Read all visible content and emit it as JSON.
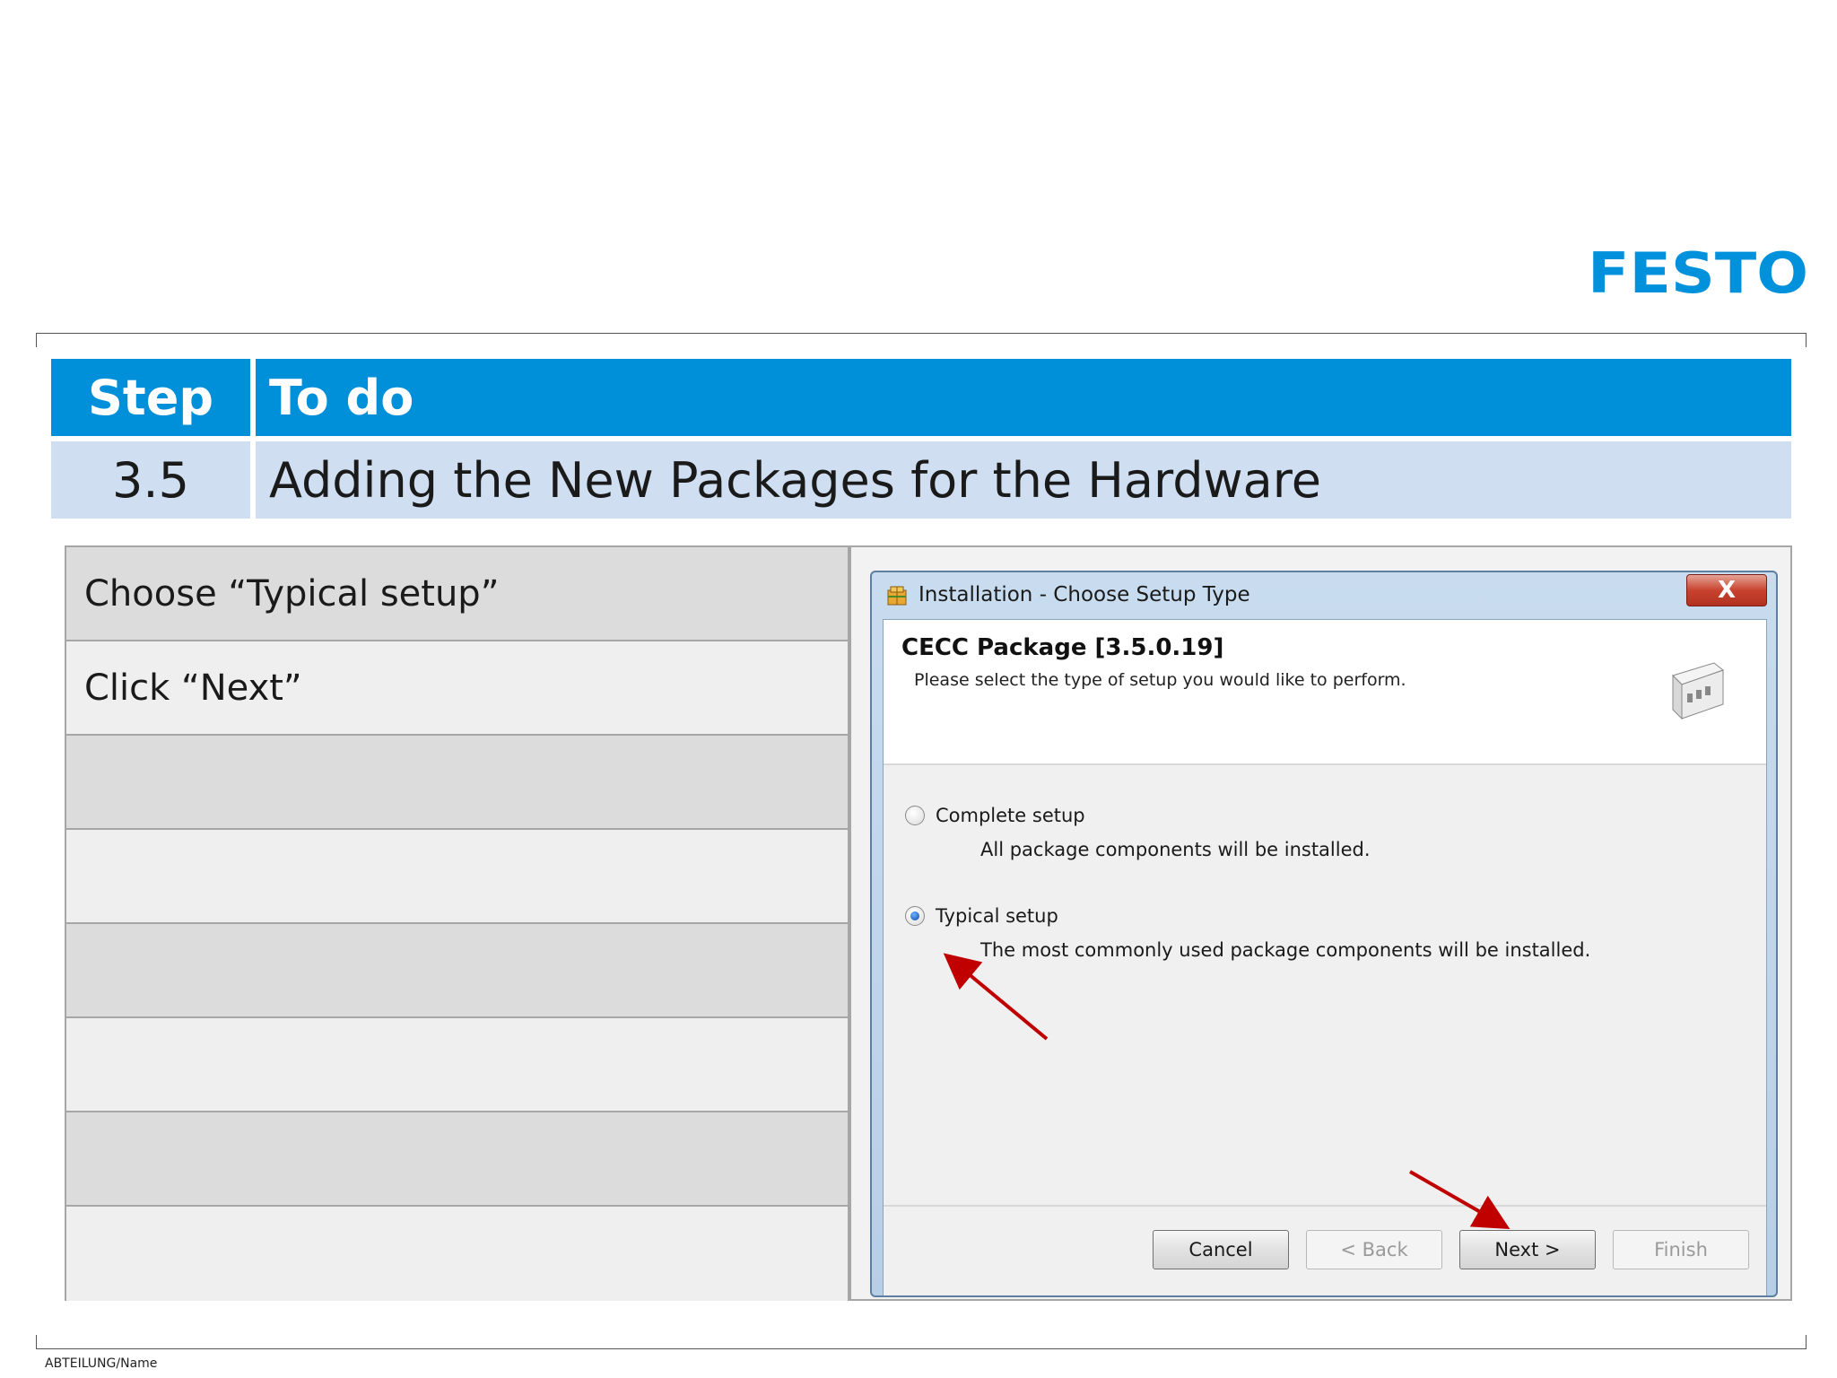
{
  "logo": {
    "text": "FESTO",
    "color": "#0091dc"
  },
  "header": {
    "col1_label": "Step",
    "col2_label": "To do",
    "step_number": "3.5",
    "step_title": "Adding the New Packages for the Hardware"
  },
  "steps": {
    "rows": [
      "Choose “Typical setup”",
      "Click “Next”",
      "",
      "",
      "",
      "",
      "",
      ""
    ]
  },
  "dialog": {
    "title": "Installation - Choose Setup Type",
    "close_label": "X",
    "package_title": "CECC Package [3.5.0.19]",
    "package_subtitle": "Please select the type of setup you would like to perform.",
    "options": [
      {
        "label": "Complete setup",
        "description": "All package components will be installed.",
        "checked": false
      },
      {
        "label": "Typical setup",
        "description": "The most commonly used package components will be installed.",
        "checked": true
      }
    ],
    "buttons": {
      "cancel": "Cancel",
      "back": "< Back",
      "next": "Next >",
      "finish": "Finish"
    }
  },
  "annotation_color": "#c00000",
  "colors": {
    "header_blue": "#0090da",
    "header_light": "#cfdef1"
  },
  "footer_text": "ABTEILUNG/Name"
}
